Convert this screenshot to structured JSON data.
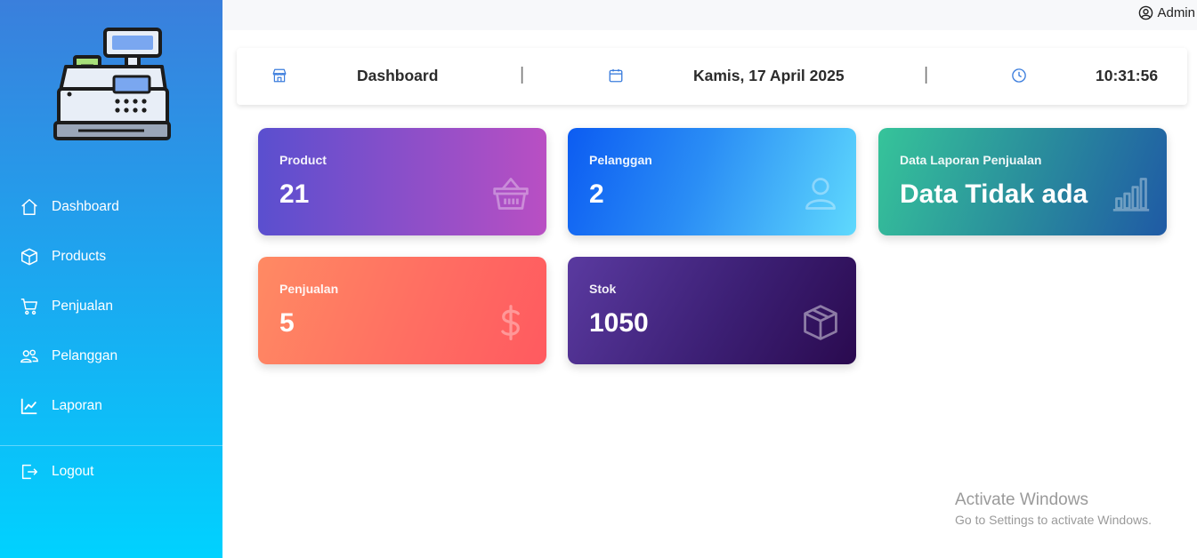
{
  "topbar": {
    "user_label": "Admin"
  },
  "sidebar": {
    "items": [
      {
        "label": "Dashboard",
        "icon": "home-icon"
      },
      {
        "label": "Products",
        "icon": "box-icon"
      },
      {
        "label": "Penjualan",
        "icon": "cart-icon"
      },
      {
        "label": "Pelanggan",
        "icon": "users-icon"
      },
      {
        "label": "Laporan",
        "icon": "chart-line-icon"
      }
    ],
    "logout_label": "Logout"
  },
  "infobar": {
    "page_title": "Dashboard",
    "separator": "|",
    "date": "Kamis, 17 April 2025",
    "time": "10:31:56"
  },
  "cards": [
    {
      "label": "Product",
      "value": "21",
      "icon": "basket-icon"
    },
    {
      "label": "Pelanggan",
      "value": "2",
      "icon": "person-icon"
    },
    {
      "label": "Data Laporan Penjualan",
      "value": "Data Tidak ada",
      "icon": "bar-chart-icon"
    },
    {
      "label": "Penjualan",
      "value": "5",
      "icon": "dollar-icon"
    },
    {
      "label": "Stok",
      "value": "1050",
      "icon": "box-icon"
    }
  ],
  "watermark": {
    "title": "Activate Windows",
    "subtitle": "Go to Settings to activate Windows."
  },
  "colors": {
    "sidebar_top": "#3a7fdc",
    "sidebar_bottom": "#00d2ff",
    "infobar_icon": "#3b7ddd"
  }
}
